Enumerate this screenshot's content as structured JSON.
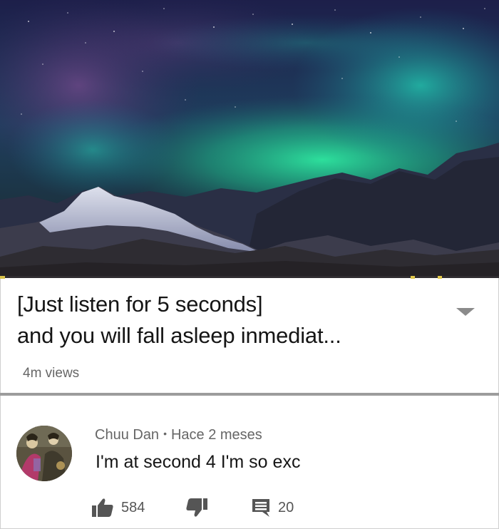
{
  "video": {
    "title_line1": "[Just listen for 5 seconds]",
    "title_line2": "and you will fall asleep inmediat...",
    "views": "4m views",
    "progress": 0.01,
    "progress_color": "#d8c24a",
    "thumbnail_icon": "aurora-mountain-thumbnail",
    "expand_icon": "caret-down-icon"
  },
  "comment": {
    "author": "Chuu Dan",
    "separator": "•",
    "time": "Hace 2 meses",
    "text": "I'm at second 4 I'm so exc",
    "likes": "584",
    "replies": "20",
    "like_icon": "thumbs-up-icon",
    "dislike_icon": "thumbs-down-icon",
    "reply_icon": "comment-icon"
  }
}
